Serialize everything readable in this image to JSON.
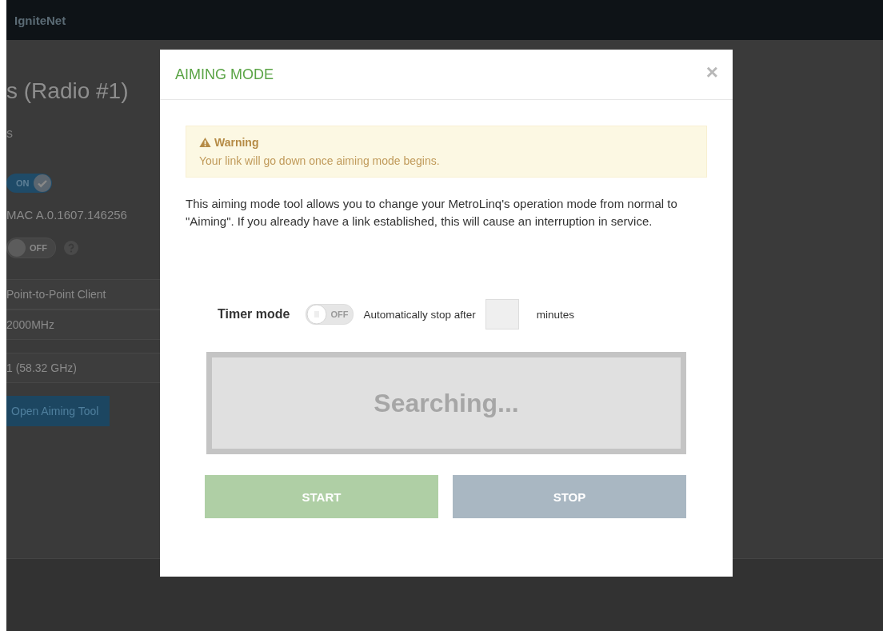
{
  "navbar": {
    "brand": "IgniteNet"
  },
  "page": {
    "title": "s (Radio #1)",
    "section": "s",
    "toggles": [
      {
        "label": "ON",
        "on": true,
        "help": false
      },
      {
        "label": "OFF",
        "on": false,
        "help": true
      }
    ],
    "firmware": "MAC A.0.1607.146256",
    "fields": [
      {
        "value": "Point-to-Point Client"
      },
      {
        "value": "2000MHz"
      },
      {
        "value": "1 (58.32 GHz)"
      }
    ],
    "button": "Open Aiming Tool"
  },
  "modal": {
    "title": "AIMING MODE",
    "close": "×",
    "warning": {
      "title": "Warning",
      "text": "Your link will go down once aiming mode begins."
    },
    "description": "This aiming mode tool allows you to change your MetroLinq's operation mode from normal to \"Aiming\". If you already have a link established, this will cause an interruption in service.",
    "timer": {
      "label": "Timer mode",
      "toggle_label": "OFF",
      "on": false,
      "prefix": "Automatically stop after",
      "suffix": "minutes"
    },
    "status": "Searching...",
    "buttons": [
      {
        "label": "START",
        "kind": "start"
      },
      {
        "label": "STOP",
        "kind": "stop"
      }
    ]
  }
}
